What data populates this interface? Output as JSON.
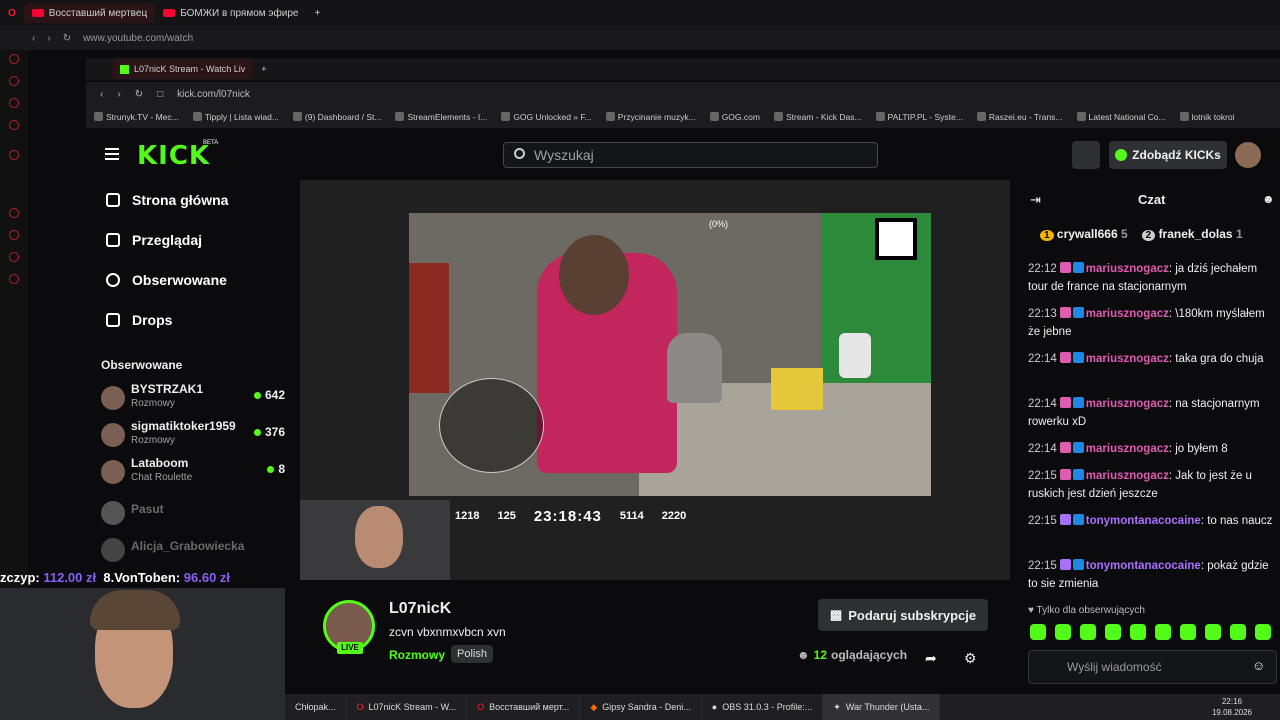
{
  "outer_browser": {
    "tabs": [
      "Восставший мертвец",
      "БОМЖИ в прямом эфире"
    ],
    "url": "www.youtube.com/watch"
  },
  "inner_browser": {
    "tabs": [
      "L07nicK Stream - Watch Liv"
    ],
    "url": "kick.com/l07nick",
    "bookmarks": [
      "Strunyk.TV - Mec...",
      "Tipply | Lista wiad...",
      "(9) Dashboard / St...",
      "StreamElements - I...",
      "GOG Unlocked » F...",
      "Przycinanie muzyk...",
      "GOG.com",
      "Stream - Kick Das...",
      "PALTIP.PL - Syste...",
      "Raszei.eu - Trans...",
      "Latest National Co...",
      "lotnik tokroi"
    ]
  },
  "kick": {
    "logo": "KICK",
    "beta": "BETA",
    "search_placeholder": "Wyszukaj",
    "get_kicks": "Zdobądź KICKs",
    "nav": [
      "Strona główna",
      "Przeglądaj",
      "Obserwowane",
      "Drops"
    ],
    "followed_title": "Obserwowane",
    "followed": [
      {
        "name": "BYSTRZAK1",
        "category": "Rozmowy",
        "viewers": "642"
      },
      {
        "name": "sigmatiktoker1959",
        "category": "Rozmowy",
        "viewers": "376"
      },
      {
        "name": "Lataboom",
        "category": "Chat Roulette",
        "viewers": "8"
      },
      {
        "name": "Pasut",
        "category": "",
        "viewers": ""
      },
      {
        "name": "Alicja_Grabowiecka",
        "category": "",
        "viewers": ""
      }
    ]
  },
  "stream_overlay": {
    "stat1": "1218",
    "stat2": "125",
    "timer": "23:18:43",
    "stat3": "5114",
    "stat4": "2220",
    "percent": "(0%)",
    "donation_ticker": [
      "zczyp: ",
      "112.00 zł",
      "8.VonToben: ",
      "96.60 zł"
    ]
  },
  "channel": {
    "name": "L07nicK",
    "title": "zcvn vbxnmxvbcn xvn",
    "category": "Rozmowy",
    "language": "Polish",
    "live": "LIVE",
    "gift_button": "Podaruj subskrypcje",
    "viewers_count": "12",
    "viewers_label": "oglądających"
  },
  "chat": {
    "title": "Czat",
    "top_gifters": [
      {
        "rank": "1",
        "name": "crywall666",
        "count": "5"
      },
      {
        "rank": "2",
        "name": "franek_dolas",
        "count": "1"
      }
    ],
    "messages": [
      {
        "time": "22:12",
        "user": "mariusznogacz",
        "text": "ja dziś jechałem tour de france na stacjonarnym",
        "color": "#e05cb1"
      },
      {
        "time": "22:13",
        "user": "mariusznogacz",
        "text": "\\180km myślałem że jebne",
        "color": "#e05cb1"
      },
      {
        "time": "22:14",
        "user": "mariusznogacz",
        "text": "taka gra do chuja",
        "color": "#e05cb1"
      },
      {
        "time": "22:14",
        "user": "mariusznogacz",
        "text": "na stacjonarnym rowerku xD",
        "color": "#e05cb1"
      },
      {
        "time": "22:14",
        "user": "mariusznogacz",
        "text": "jo byłem 8",
        "color": "#e05cb1"
      },
      {
        "time": "22:15",
        "user": "mariusznogacz",
        "text": "Jak to jest że u ruskich jest dzień jeszcze",
        "color": "#e05cb1"
      },
      {
        "time": "22:15",
        "user": "tonymontanacocaine",
        "text": "to nas naucz",
        "color": "#a770ff"
      },
      {
        "time": "22:15",
        "user": "tonymontanacocaine",
        "text": "pokaż gdzie to sie zmienia",
        "color": "#a770ff"
      }
    ],
    "followers_only": "Tylko dla obserwujących",
    "input_placeholder": "Wyślij wiadomość"
  },
  "taskbar": {
    "items": [
      "Chłopak...",
      "L07nicK Stream - W...",
      "Восставший мерт...",
      "Gipsy Sandra - Deni...",
      "OBS 31.0.3 - Profile:...",
      "War Thunder (Usta..."
    ],
    "time": "22:16",
    "date": "19.08.2026"
  }
}
